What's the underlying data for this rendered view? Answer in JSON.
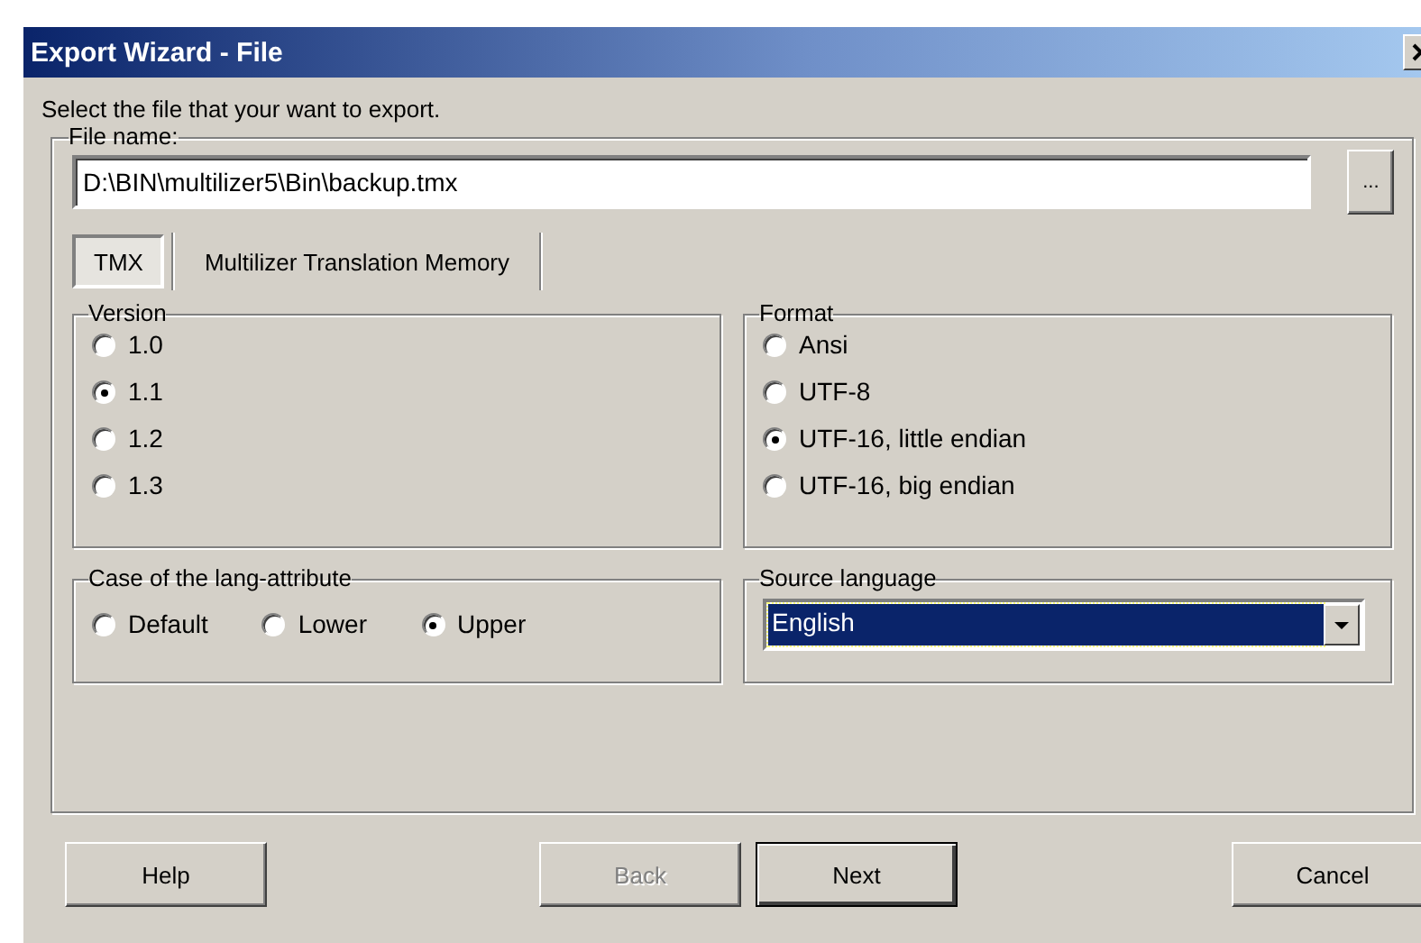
{
  "window": {
    "title": "Export Wizard - File"
  },
  "instruction": "Select the file that your want to export.",
  "file_group": {
    "label": "File name:",
    "value": "D:\\BIN\\multilizer5\\Bin\\backup.tmx",
    "browse_button": "..."
  },
  "tabs": [
    {
      "label": "TMX",
      "selected": true
    },
    {
      "label": "Multilizer Translation Memory",
      "selected": false
    }
  ],
  "version": {
    "label": "Version",
    "options": [
      {
        "label": "1.0",
        "selected": false
      },
      {
        "label": "1.1",
        "selected": true
      },
      {
        "label": "1.2",
        "selected": false
      },
      {
        "label": "1.3",
        "selected": false
      }
    ]
  },
  "format": {
    "label": "Format",
    "options": [
      {
        "label": "Ansi",
        "selected": false
      },
      {
        "label": "UTF-8",
        "selected": false
      },
      {
        "label": "UTF-16, little endian",
        "selected": true
      },
      {
        "label": "UTF-16, big endian",
        "selected": false
      }
    ]
  },
  "lang_case": {
    "label": "Case of the lang-attribute",
    "options": [
      {
        "label": "Default",
        "selected": false
      },
      {
        "label": "Lower",
        "selected": false
      },
      {
        "label": "Upper",
        "selected": true
      }
    ]
  },
  "source_language": {
    "label": "Source language",
    "value": "English"
  },
  "buttons": [
    {
      "label": "Help",
      "disabled": false,
      "default": false
    },
    {
      "label": "Back",
      "disabled": true,
      "default": false
    },
    {
      "label": "Next",
      "disabled": false,
      "default": true
    },
    {
      "label": "Cancel",
      "disabled": false,
      "default": false
    }
  ]
}
